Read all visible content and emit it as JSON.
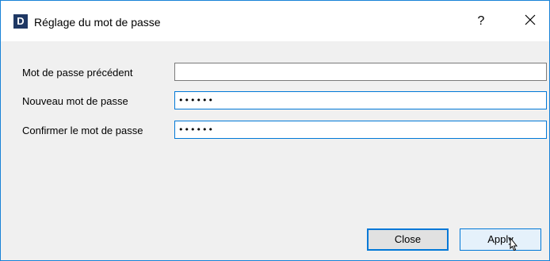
{
  "window": {
    "title": "Réglage du mot de passe",
    "app_icon_letter": "D",
    "help_glyph": "?",
    "close_icon": "close-icon"
  },
  "form": {
    "old_password": {
      "label": "Mot de passe précédent",
      "value": ""
    },
    "new_password": {
      "label": "Nouveau mot de passe",
      "value": "••••••"
    },
    "confirm_password": {
      "label": "Confirmer le mot de passe",
      "value": "••••••"
    }
  },
  "buttons": {
    "close_label": "Close",
    "apply_label": "Apply"
  },
  "colors": {
    "accent": "#0078d7",
    "window_border": "#1883d7",
    "app_icon_bg": "#1f3864"
  }
}
